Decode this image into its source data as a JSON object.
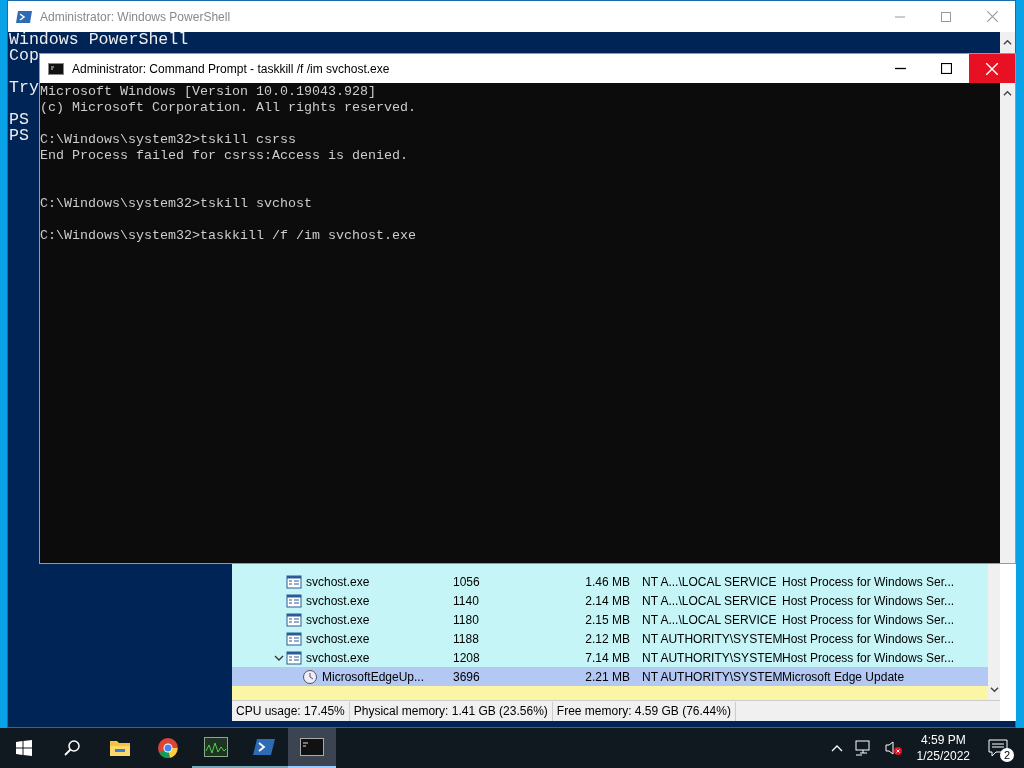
{
  "powershell": {
    "title": "Administrator: Windows PowerShell",
    "lines": [
      {
        "kind": "banner",
        "text": "Windows PowerShell"
      },
      {
        "kind": "banner",
        "text": "Cop"
      },
      {
        "kind": "hint",
        "text": "Try"
      },
      {
        "kind": "prompt",
        "text": "PS"
      },
      {
        "kind": "prompt",
        "text": "PS"
      }
    ]
  },
  "cmd": {
    "title": "Administrator: Command Prompt - taskkill  /f /im svchost.exe",
    "lines": [
      {
        "kind": "banner",
        "text": "Microsoft Windows [Version 10.0.19043.928]"
      },
      {
        "kind": "banner",
        "text": "(c) Microsoft Corporation. All rights reserved."
      },
      {
        "kind": "command",
        "text": "C:\\Windows\\system32>tskill csrss"
      },
      {
        "kind": "output",
        "text": "End Process failed for csrss:Access is denied."
      },
      {
        "kind": "command",
        "text": "C:\\Windows\\system32>tskill svchost"
      },
      {
        "kind": "command",
        "text": "C:\\Windows\\system32>taskkill /f /im svchost.exe"
      }
    ]
  },
  "task_manager": {
    "rows": [
      {
        "kind": "process",
        "name": "svchost.exe",
        "pid": "1056",
        "memory": "1.46 MB",
        "user": "NT A...\\LOCAL SERVICE",
        "description": "Host Process for Windows Ser...",
        "selected": false
      },
      {
        "kind": "process",
        "name": "svchost.exe",
        "pid": "1140",
        "memory": "2.14 MB",
        "user": "NT A...\\LOCAL SERVICE",
        "description": "Host Process for Windows Ser...",
        "selected": false
      },
      {
        "kind": "process",
        "name": "svchost.exe",
        "pid": "1180",
        "memory": "2.15 MB",
        "user": "NT A...\\LOCAL SERVICE",
        "description": "Host Process for Windows Ser...",
        "selected": false
      },
      {
        "kind": "process",
        "name": "svchost.exe",
        "pid": "1188",
        "memory": "2.12 MB",
        "user": "NT AUTHORITY\\SYSTEM",
        "description": "Host Process for Windows Ser...",
        "selected": false
      },
      {
        "kind": "group",
        "name": "svchost.exe",
        "pid": "1208",
        "memory": "7.14 MB",
        "user": "NT AUTHORITY\\SYSTEM",
        "description": "Host Process for Windows Ser...",
        "selected": false,
        "expanded": true
      },
      {
        "kind": "child",
        "name": "MicrosoftEdgeUp...",
        "pid": "3696",
        "memory": "2.21 MB",
        "user": "NT AUTHORITY\\SYSTEM",
        "description": "Microsoft Edge Update",
        "selected": true
      }
    ],
    "status": [
      "CPU usage: 17.45%",
      "Physical memory: 1.41 GB (23.56%)",
      "Free memory: 4.59 GB (76.44%)"
    ]
  },
  "taskbar": {
    "apps": [
      {
        "kind": "start",
        "running": false,
        "selected": false
      },
      {
        "kind": "search",
        "running": false,
        "selected": false
      },
      {
        "kind": "folder",
        "running": false,
        "selected": false
      },
      {
        "kind": "browser",
        "running": false,
        "selected": false
      },
      {
        "kind": "monitor",
        "running": true,
        "selected": false
      },
      {
        "kind": "powershell",
        "running": true,
        "selected": false
      },
      {
        "kind": "console",
        "running": true,
        "selected": true
      }
    ],
    "time": "4:59 PM",
    "date": "1/25/2022",
    "notifications": "2"
  }
}
